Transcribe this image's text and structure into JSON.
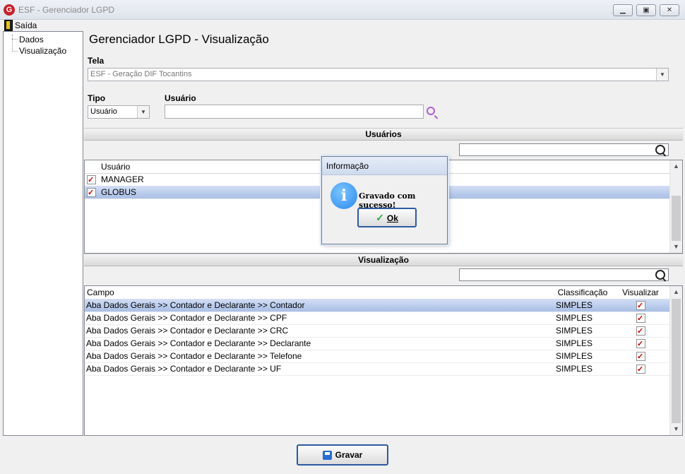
{
  "window": {
    "title": "ESF - Gerenciador LGPD",
    "icon_letter": "G"
  },
  "menu": {
    "exit_label": "Saída"
  },
  "tree": {
    "items": [
      "Dados",
      "Visualização"
    ]
  },
  "page": {
    "title": "Gerenciador LGPD - Visualização"
  },
  "form": {
    "tela_label": "Tela",
    "tela_value": "ESF - Geração DIF Tocantins",
    "tipo_label": "Tipo",
    "tipo_value": "Usuário",
    "usuario_label": "Usuário",
    "usuario_value": ""
  },
  "users_section": {
    "header": "Usuários",
    "search_value": "",
    "column": "Usuário",
    "rows": [
      {
        "name": "MANAGER",
        "checked": true,
        "selected": false
      },
      {
        "name": "GLOBUS",
        "checked": true,
        "selected": true
      }
    ]
  },
  "view_section": {
    "header": "Visualização",
    "search_value": "",
    "columns": [
      "Campo",
      "Classificação",
      "Visualizar"
    ],
    "rows": [
      {
        "campo": "Aba Dados Gerais >> Contador e Declarante >> Contador",
        "classificacao": "SIMPLES",
        "visualizar": true
      },
      {
        "campo": "Aba Dados Gerais >> Contador e Declarante >> CPF",
        "classificacao": "SIMPLES",
        "visualizar": true
      },
      {
        "campo": "Aba Dados Gerais >> Contador e Declarante >> CRC",
        "classificacao": "SIMPLES",
        "visualizar": true
      },
      {
        "campo": "Aba Dados Gerais >> Contador e Declarante >> Declarante",
        "classificacao": "SIMPLES",
        "visualizar": true
      },
      {
        "campo": "Aba Dados Gerais >> Contador e Declarante >> Telefone",
        "classificacao": "SIMPLES",
        "visualizar": true
      },
      {
        "campo": "Aba Dados Gerais >> Contador e Declarante >> UF",
        "classificacao": "SIMPLES",
        "visualizar": true
      }
    ]
  },
  "dialog": {
    "title": "Informação",
    "message": "Gravado com sucesso!",
    "ok_label": "Ok"
  },
  "footer": {
    "save_label": "Gravar"
  }
}
